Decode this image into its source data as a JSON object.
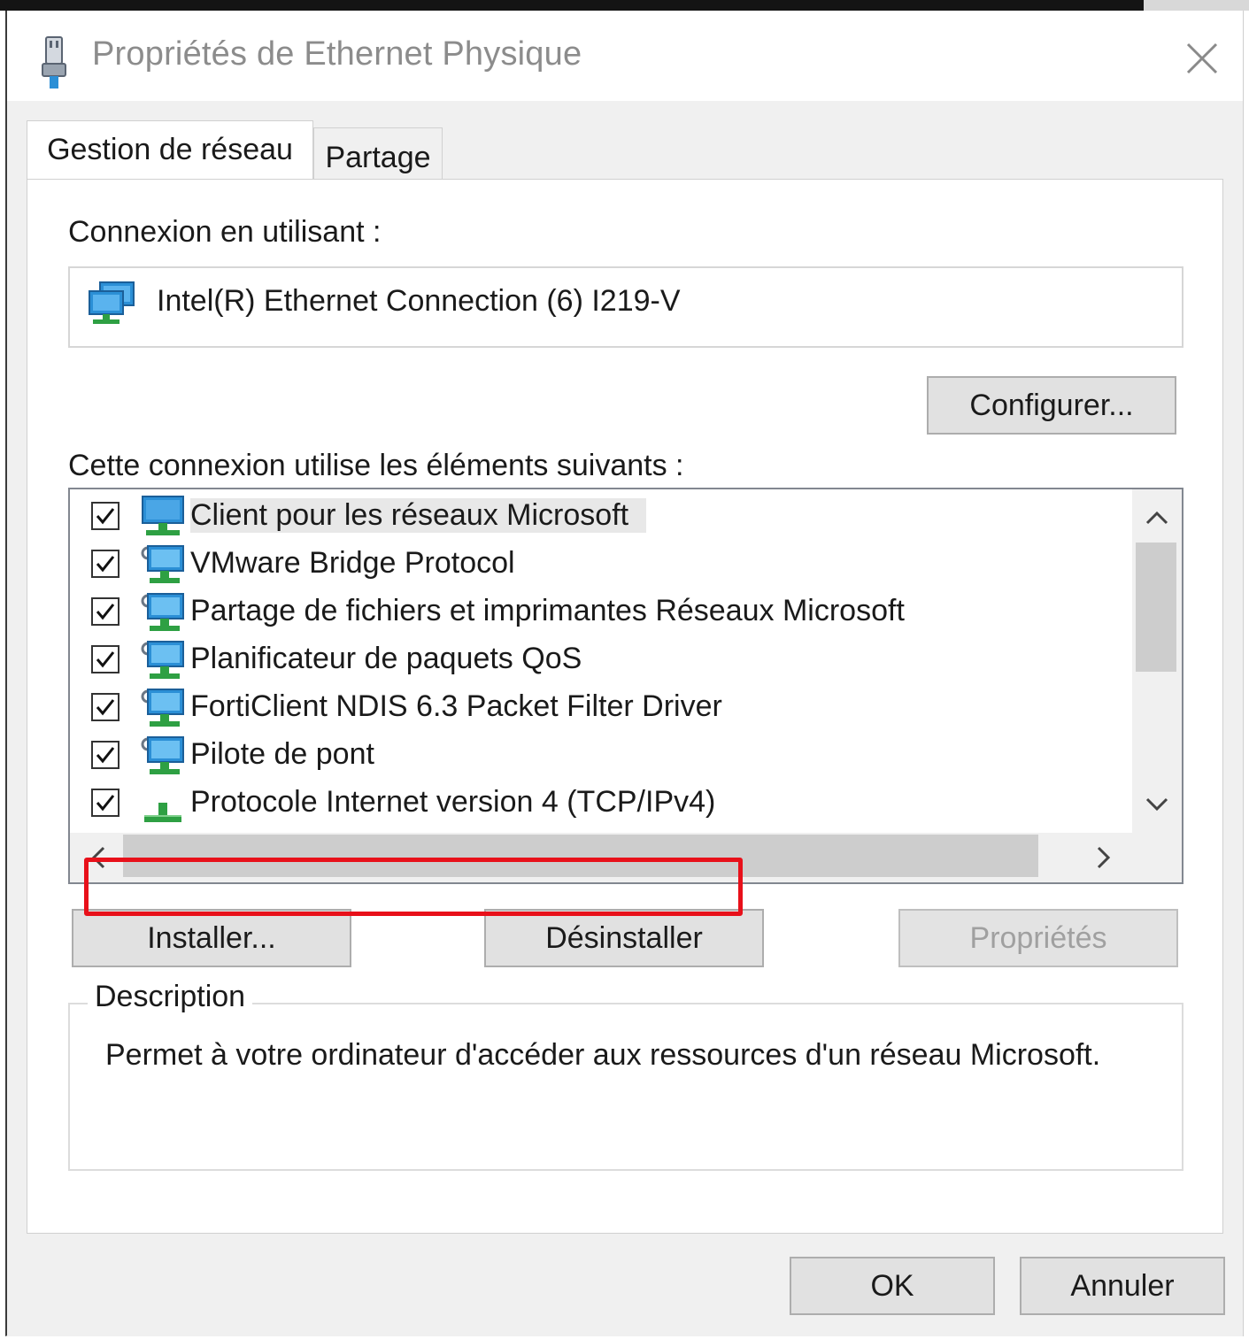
{
  "window": {
    "title": "Propriétés de Ethernet Physique"
  },
  "tabs": [
    {
      "label": "Gestion de réseau"
    },
    {
      "label": "Partage"
    }
  ],
  "connection": {
    "label": "Connexion en utilisant :",
    "adapter_name": "Intel(R) Ethernet Connection (6) I219-V",
    "configure_label": "Configurer..."
  },
  "components": {
    "label": "Cette connexion utilise les éléments suivants :",
    "items": [
      {
        "label": "Client pour les réseaux Microsoft",
        "checked": true,
        "icon": "network-client-icon"
      },
      {
        "label": "VMware Bridge Protocol",
        "checked": true,
        "icon": "network-service-icon"
      },
      {
        "label": "Partage de fichiers et imprimantes Réseaux Microsoft",
        "checked": true,
        "icon": "network-service-icon"
      },
      {
        "label": "Planificateur de paquets QoS",
        "checked": true,
        "icon": "network-service-icon"
      },
      {
        "label": "FortiClient NDIS 6.3 Packet Filter Driver",
        "checked": true,
        "icon": "network-service-icon"
      },
      {
        "label": "Pilote de pont",
        "checked": true,
        "icon": "network-service-icon"
      },
      {
        "label": "Protocole Internet version 4 (TCP/IPv4)",
        "checked": true,
        "icon": "protocol-icon"
      }
    ]
  },
  "buttons": {
    "install": "Installer...",
    "uninstall": "Désinstaller",
    "properties": "Propriétés",
    "ok": "OK",
    "cancel": "Annuler"
  },
  "description": {
    "title": "Description",
    "text": "Permet à votre ordinateur d'accéder aux ressources d'un réseau Microsoft."
  },
  "colors": {
    "highlight": "#e8101a",
    "network_icon": "#2b8fd6",
    "protocol_icon": "#2ea043"
  }
}
